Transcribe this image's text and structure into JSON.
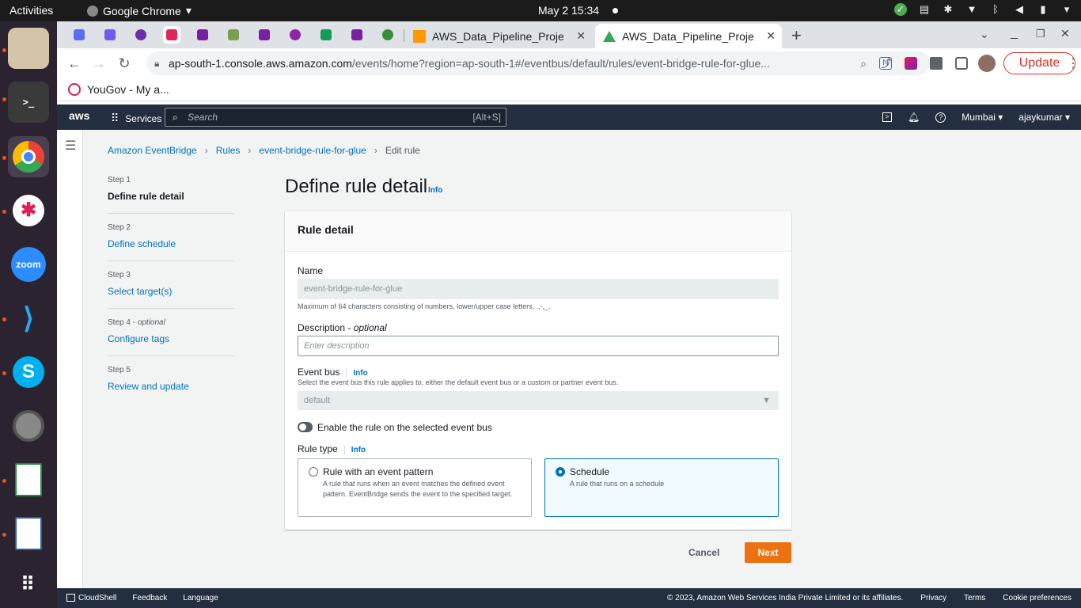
{
  "os": {
    "activities": "Activities",
    "app_name": "Google Chrome",
    "clock": "May 2  15:34"
  },
  "browser": {
    "tabs": [
      {
        "label": "AWS_Data_Pipeline_Proje"
      },
      {
        "label": "AWS_Data_Pipeline_Proje"
      }
    ],
    "url_host": "ap-south-1.console.aws.amazon.com",
    "url_path": "/events/home?region=ap-south-1#/eventbus/default/rules/event-bridge-rule-for-glue...",
    "update_label": "Update",
    "bookmark": "YouGov - My a..."
  },
  "aws_header": {
    "logo": "aws",
    "services": "Services",
    "search_placeholder": "Search",
    "search_shortcut": "[Alt+S]",
    "region": "Mumbai",
    "user": "ajaykumar"
  },
  "breadcrumb": [
    {
      "label": "Amazon EventBridge"
    },
    {
      "label": "Rules"
    },
    {
      "label": "event-bridge-rule-for-glue"
    },
    {
      "label": "Edit rule"
    }
  ],
  "steps": [
    {
      "label": "Step 1",
      "name": "Define rule detail"
    },
    {
      "label": "Step 2",
      "name": "Define schedule"
    },
    {
      "label": "Step 3",
      "name": "Select target(s)"
    },
    {
      "label": "Step 4",
      "optional": "optional",
      "name": "Configure tags"
    },
    {
      "label": "Step 5",
      "name": "Review and update"
    }
  ],
  "page": {
    "title": "Define rule detail",
    "info": "Info"
  },
  "panel": {
    "title": "Rule detail",
    "name_label": "Name",
    "name_value": "event-bridge-rule-for-glue",
    "name_hint": "Maximum of 64 characters consisting of numbers, lower/upper case letters, .,-,_.",
    "desc_label": "Description - ",
    "desc_optional": "optional",
    "desc_placeholder": "Enter description",
    "bus_label": "Event bus",
    "bus_info": "Info",
    "bus_hint": "Select the event bus this rule applies to, either the default event bus or a custom or partner event bus.",
    "bus_value": "default",
    "toggle_label": "Enable the rule on the selected event bus",
    "toggle_on": false,
    "type_label": "Rule type",
    "type_info": "Info",
    "options": [
      {
        "title": "Rule with an event pattern",
        "desc": "A rule that runs when an event matches the defined event pattern. EventBridge sends the event to the specified target.",
        "selected": false
      },
      {
        "title": "Schedule",
        "desc": "A rule that runs on a schedule",
        "selected": true
      }
    ]
  },
  "actions": {
    "cancel": "Cancel",
    "next": "Next"
  },
  "footer": {
    "cloudshell": "CloudShell",
    "feedback": "Feedback",
    "language": "Language",
    "copyright": "© 2023, Amazon Web Services India Private Limited or its affiliates.",
    "privacy": "Privacy",
    "terms": "Terms",
    "cookies": "Cookie preferences"
  },
  "colors": {
    "aws_nav": "#232f3e",
    "link": "#0073bb",
    "primary_button": "#ec7211",
    "dock": "#2c2330"
  }
}
